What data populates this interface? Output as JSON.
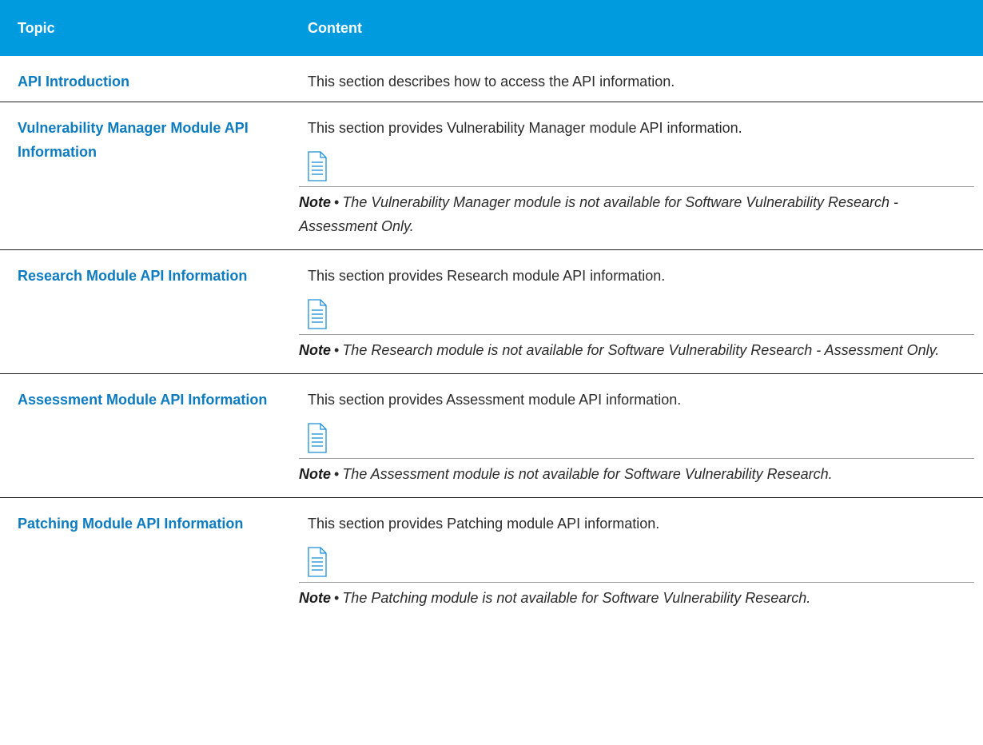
{
  "table": {
    "headers": {
      "topic": "Topic",
      "content": "Content"
    },
    "rows": [
      {
        "topic": "API Introduction",
        "description": "This section describes how to access the API information."
      },
      {
        "topic": "Vulnerability Manager Module API Information",
        "description": "This section provides Vulnerability Manager module API information.",
        "note_label": "Note",
        "note_bullet": "•",
        "note_text": "The Vulnerability Manager module is not available for Software Vulnerability Research - Assessment Only."
      },
      {
        "topic": "Research Module API Information",
        "description": "This section provides Research module API information.",
        "note_label": "Note",
        "note_bullet": "•",
        "note_text": "The Research module is not available for Software Vulnerability Research - Assessment Only."
      },
      {
        "topic": "Assessment Module API Information",
        "description": "This section provides Assessment module API information.",
        "note_label": "Note",
        "note_bullet": "•",
        "note_text": "The Assessment module is not available for Software Vulnerability Research."
      },
      {
        "topic": "Patching Module API Information",
        "description": "This section provides Patching module API information.",
        "note_label": "Note",
        "note_bullet": "•",
        "note_text": "The Patching module is not available for Software Vulnerability Research."
      }
    ]
  },
  "colors": {
    "header_bg": "#009ade",
    "link": "#0c7bc0",
    "icon": "#1a8ed6"
  },
  "icons": {
    "note": "document-note-icon"
  }
}
